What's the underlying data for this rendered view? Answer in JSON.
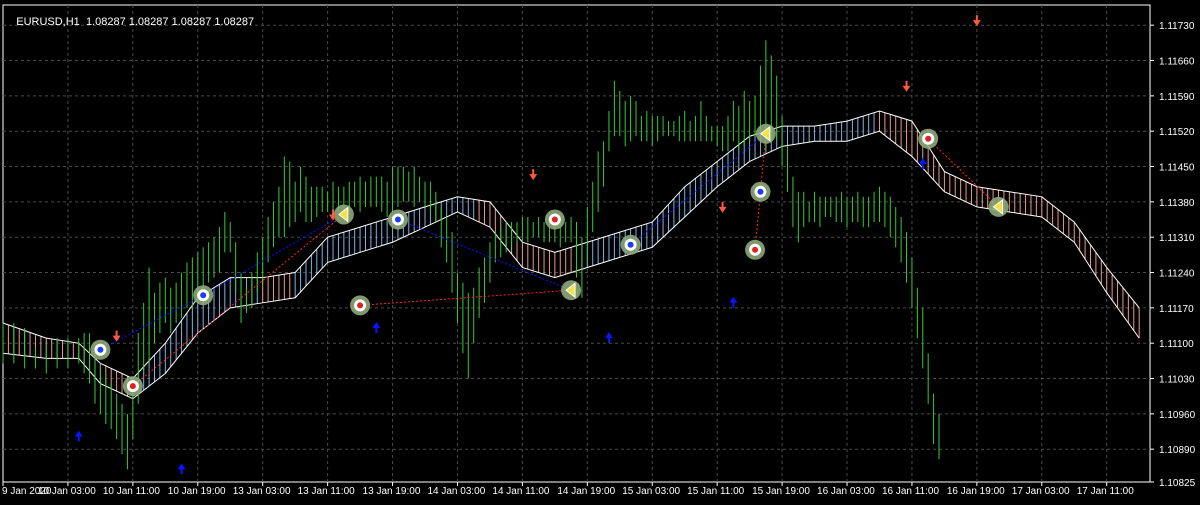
{
  "header": {
    "symbol_tf": "EURUSD,H1",
    "quote": "1.08287 1.08287 1.08287 1.08287"
  },
  "colors": {
    "background": "#000000",
    "grid": "#4a4a4a",
    "axis": "#ffffff",
    "text": "#ffffff",
    "candle": "#33cc33",
    "band_up": "#7fb2e6",
    "band_down": "#e89a8f",
    "band_edge": "#ffffff",
    "arrow_up": "#0a14ff",
    "arrow_down": "#ff5a40",
    "zz_up": "#0a14ff",
    "zz_down": "#ff2020",
    "marker_ring": "#8ea87a"
  },
  "chart_data": {
    "type": "line",
    "title": "EURUSD,H1",
    "y_ticks": [
      "1.11730",
      "1.11660",
      "1.11590",
      "1.11520",
      "1.11450",
      "1.11380",
      "1.11310",
      "1.11240",
      "1.11170",
      "1.11100",
      "1.11030",
      "1.10960",
      "1.10890",
      "1.10825"
    ],
    "ylim": [
      1.10825,
      1.1177
    ],
    "x_labels": [
      "9 Jan 2020",
      "10 Jan 03:00",
      "10 Jan 11:00",
      "10 Jan 19:00",
      "13 Jan 03:00",
      "13 Jan 11:00",
      "13 Jan 19:00",
      "14 Jan 03:00",
      "14 Jan 11:00",
      "14 Jan 19:00",
      "15 Jan 03:00",
      "15 Jan 11:00",
      "15 Jan 19:00",
      "16 Jan 03:00",
      "16 Jan 11:00",
      "16 Jan 19:00",
      "17 Jan 03:00",
      "17 Jan 11:00"
    ],
    "band": {
      "upper": [
        [
          0,
          1.1114
        ],
        [
          8,
          1.1111
        ],
        [
          14,
          1.111
        ],
        [
          18,
          1.1106
        ],
        [
          24,
          1.1103
        ],
        [
          30,
          1.111
        ],
        [
          36,
          1.1119
        ],
        [
          42,
          1.1123
        ],
        [
          48,
          1.1123
        ],
        [
          54,
          1.1124
        ],
        [
          60,
          1.1131
        ],
        [
          66,
          1.1133
        ],
        [
          72,
          1.1135
        ],
        [
          78,
          1.1137
        ],
        [
          84,
          1.1139
        ],
        [
          90,
          1.1138
        ],
        [
          96,
          1.113
        ],
        [
          102,
          1.1128
        ],
        [
          108,
          1.113
        ],
        [
          114,
          1.1132
        ],
        [
          120,
          1.1134
        ],
        [
          126,
          1.1141
        ],
        [
          132,
          1.1146
        ],
        [
          138,
          1.1151
        ],
        [
          144,
          1.1153
        ],
        [
          150,
          1.1153
        ],
        [
          156,
          1.1154
        ],
        [
          162,
          1.1156
        ],
        [
          168,
          1.1154
        ],
        [
          174,
          1.1144
        ],
        [
          180,
          1.1141
        ],
        [
          186,
          1.114
        ],
        [
          192,
          1.1139
        ],
        [
          198,
          1.1134
        ],
        [
          204,
          1.1125
        ],
        [
          210,
          1.1117
        ]
      ],
      "lower": [
        [
          0,
          1.1108
        ],
        [
          8,
          1.1107
        ],
        [
          14,
          1.1107
        ],
        [
          18,
          1.1102
        ],
        [
          24,
          1.1099
        ],
        [
          30,
          1.1104
        ],
        [
          36,
          1.1112
        ],
        [
          42,
          1.1117
        ],
        [
          48,
          1.1118
        ],
        [
          54,
          1.1119
        ],
        [
          60,
          1.1126
        ],
        [
          66,
          1.1128
        ],
        [
          72,
          1.113
        ],
        [
          78,
          1.1133
        ],
        [
          84,
          1.1136
        ],
        [
          90,
          1.1133
        ],
        [
          96,
          1.1125
        ],
        [
          102,
          1.1123
        ],
        [
          108,
          1.1125
        ],
        [
          114,
          1.1127
        ],
        [
          120,
          1.1129
        ],
        [
          126,
          1.1135
        ],
        [
          132,
          1.1141
        ],
        [
          138,
          1.1146
        ],
        [
          144,
          1.1149
        ],
        [
          150,
          1.115
        ],
        [
          156,
          1.115
        ],
        [
          162,
          1.1152
        ],
        [
          168,
          1.1147
        ],
        [
          174,
          1.114
        ],
        [
          180,
          1.1137
        ],
        [
          186,
          1.1136
        ],
        [
          192,
          1.1135
        ],
        [
          198,
          1.113
        ],
        [
          204,
          1.112
        ],
        [
          210,
          1.1111
        ]
      ],
      "direction": [
        [
          0,
          "down"
        ],
        [
          18,
          "down"
        ],
        [
          24,
          "up"
        ],
        [
          48,
          "down"
        ],
        [
          54,
          "up"
        ],
        [
          88,
          "down"
        ],
        [
          108,
          "up"
        ],
        [
          162,
          "down"
        ]
      ]
    },
    "bars": [
      [
        0,
        1.1106,
        1.1114
      ],
      [
        2,
        1.1106,
        1.1114
      ],
      [
        4,
        1.1105,
        1.1113
      ],
      [
        6,
        1.1105,
        1.1109
      ],
      [
        8,
        1.1104,
        1.111
      ],
      [
        10,
        1.1105,
        1.1111
      ],
      [
        12,
        1.1105,
        1.1111
      ],
      [
        14,
        1.1106,
        1.1111
      ],
      [
        15,
        1.1104,
        1.1112
      ],
      [
        16,
        1.1102,
        1.1112
      ],
      [
        17,
        1.1098,
        1.1108
      ],
      [
        18,
        1.1096,
        1.1106
      ],
      [
        19,
        1.1094,
        1.1104
      ],
      [
        20,
        1.1093,
        1.1102
      ],
      [
        21,
        1.1091,
        1.11
      ],
      [
        22,
        1.1088,
        1.1098
      ],
      [
        23,
        1.1085,
        1.1096
      ],
      [
        24,
        1.1091,
        1.11
      ],
      [
        25,
        1.1098,
        1.1112
      ],
      [
        26,
        1.1104,
        1.1118
      ],
      [
        27,
        1.1106,
        1.1125
      ],
      [
        28,
        1.111,
        1.112
      ],
      [
        29,
        1.1112,
        1.1122
      ],
      [
        30,
        1.1114,
        1.1123
      ],
      [
        31,
        1.1112,
        1.1121
      ],
      [
        32,
        1.1114,
        1.1122
      ],
      [
        33,
        1.1115,
        1.1124
      ],
      [
        34,
        1.1117,
        1.1126
      ],
      [
        35,
        1.1117,
        1.1127
      ],
      [
        36,
        1.1119,
        1.1128
      ],
      [
        37,
        1.112,
        1.1129
      ],
      [
        38,
        1.1122,
        1.113
      ],
      [
        39,
        1.1123,
        1.1131
      ],
      [
        40,
        1.1124,
        1.1133
      ],
      [
        41,
        1.1128,
        1.1136
      ],
      [
        42,
        1.1128,
        1.1134
      ],
      [
        43,
        1.112,
        1.113
      ],
      [
        44,
        1.1114,
        1.1124
      ],
      [
        45,
        1.1116,
        1.1121
      ],
      [
        46,
        1.1117,
        1.1124
      ],
      [
        47,
        1.112,
        1.1128
      ],
      [
        48,
        1.1122,
        1.1131
      ],
      [
        49,
        1.1126,
        1.1135
      ],
      [
        50,
        1.1129,
        1.1138
      ],
      [
        51,
        1.1131,
        1.1141
      ],
      [
        52,
        1.1131,
        1.1147
      ],
      [
        53,
        1.1133,
        1.1146
      ],
      [
        54,
        1.1134,
        1.1142
      ],
      [
        55,
        1.1136,
        1.1145
      ],
      [
        56,
        1.1134,
        1.1143
      ],
      [
        57,
        1.1134,
        1.1141
      ],
      [
        58,
        1.1135,
        1.1141
      ],
      [
        59,
        1.1136,
        1.1141
      ],
      [
        60,
        1.1136,
        1.114
      ],
      [
        61,
        1.1136,
        1.1142
      ],
      [
        62,
        1.1136,
        1.1141
      ],
      [
        63,
        1.1135,
        1.1141
      ],
      [
        64,
        1.1136,
        1.1142
      ],
      [
        65,
        1.1137,
        1.1142
      ],
      [
        66,
        1.1136,
        1.1143
      ],
      [
        67,
        1.1137,
        1.1142
      ],
      [
        68,
        1.1137,
        1.1143
      ],
      [
        69,
        1.1137,
        1.1143
      ],
      [
        70,
        1.1136,
        1.1143
      ],
      [
        71,
        1.1135,
        1.1142
      ],
      [
        72,
        1.1136,
        1.1145
      ],
      [
        73,
        1.1137,
        1.1145
      ],
      [
        74,
        1.1138,
        1.1145
      ],
      [
        75,
        1.1138,
        1.1144
      ],
      [
        76,
        1.1137,
        1.1145
      ],
      [
        77,
        1.1138,
        1.1143
      ],
      [
        78,
        1.1137,
        1.1142
      ],
      [
        79,
        1.1136,
        1.1142
      ],
      [
        80,
        1.1134,
        1.114
      ],
      [
        81,
        1.1129,
        1.1137
      ],
      [
        82,
        1.1126,
        1.1135
      ],
      [
        83,
        1.112,
        1.1132
      ],
      [
        84,
        1.1114,
        1.1124
      ],
      [
        85,
        1.1108,
        1.1122
      ],
      [
        86,
        1.1103,
        1.112
      ],
      [
        87,
        1.111,
        1.1121
      ],
      [
        88,
        1.1115,
        1.1125
      ],
      [
        89,
        1.1118,
        1.1127
      ],
      [
        90,
        1.1122,
        1.113
      ],
      [
        91,
        1.1126,
        1.1132
      ],
      [
        92,
        1.1127,
        1.1133
      ],
      [
        93,
        1.1128,
        1.1134
      ],
      [
        94,
        1.1129,
        1.1134
      ],
      [
        95,
        1.113,
        1.1134
      ],
      [
        96,
        1.113,
        1.1135
      ],
      [
        97,
        1.113,
        1.1135
      ],
      [
        98,
        1.1131,
        1.1134
      ],
      [
        99,
        1.1131,
        1.1135
      ],
      [
        100,
        1.113,
        1.1134
      ],
      [
        101,
        1.113,
        1.1134
      ],
      [
        102,
        1.113,
        1.1134
      ],
      [
        103,
        1.1129,
        1.1134
      ],
      [
        104,
        1.113,
        1.1134
      ],
      [
        105,
        1.113,
        1.1135
      ],
      [
        106,
        1.1123,
        1.1134
      ],
      [
        107,
        1.1119,
        1.1131
      ],
      [
        108,
        1.1126,
        1.1137
      ],
      [
        109,
        1.1132,
        1.1142
      ],
      [
        110,
        1.1136,
        1.1148
      ],
      [
        111,
        1.1141,
        1.115
      ],
      [
        112,
        1.1148,
        1.1156
      ],
      [
        113,
        1.1151,
        1.1162
      ],
      [
        114,
        1.1151,
        1.116
      ],
      [
        115,
        1.1149,
        1.1158
      ],
      [
        116,
        1.115,
        1.1159
      ],
      [
        117,
        1.1151,
        1.1158
      ],
      [
        118,
        1.115,
        1.1155
      ],
      [
        119,
        1.115,
        1.1156
      ],
      [
        120,
        1.1149,
        1.1155
      ],
      [
        121,
        1.115,
        1.1155
      ],
      [
        122,
        1.1151,
        1.1155
      ],
      [
        123,
        1.1151,
        1.1154
      ],
      [
        124,
        1.1151,
        1.1154
      ],
      [
        125,
        1.115,
        1.1155
      ],
      [
        126,
        1.115,
        1.1156
      ],
      [
        127,
        1.115,
        1.1154
      ],
      [
        128,
        1.115,
        1.1155
      ],
      [
        129,
        1.115,
        1.1158
      ],
      [
        130,
        1.115,
        1.1155
      ],
      [
        131,
        1.115,
        1.1153
      ],
      [
        132,
        1.1149,
        1.1153
      ],
      [
        133,
        1.1148,
        1.1153
      ],
      [
        134,
        1.1148,
        1.1155
      ],
      [
        135,
        1.115,
        1.1158
      ],
      [
        136,
        1.1148,
        1.1157
      ],
      [
        137,
        1.1149,
        1.116
      ],
      [
        138,
        1.115,
        1.1158
      ],
      [
        139,
        1.1151,
        1.1159
      ],
      [
        140,
        1.1151,
        1.1165
      ],
      [
        141,
        1.1148,
        1.117
      ],
      [
        142,
        1.115,
        1.1167
      ],
      [
        143,
        1.115,
        1.1163
      ],
      [
        144,
        1.1145,
        1.1155
      ],
      [
        145,
        1.114,
        1.1149
      ],
      [
        146,
        1.1133,
        1.1143
      ],
      [
        147,
        1.113,
        1.114
      ],
      [
        148,
        1.1133,
        1.114
      ],
      [
        149,
        1.1134,
        1.1138
      ],
      [
        150,
        1.1134,
        1.114
      ],
      [
        151,
        1.1133,
        1.1139
      ],
      [
        152,
        1.1135,
        1.1139
      ],
      [
        153,
        1.1135,
        1.1139
      ],
      [
        154,
        1.1134,
        1.1139
      ],
      [
        155,
        1.1134,
        1.114
      ],
      [
        156,
        1.1133,
        1.1139
      ],
      [
        157,
        1.1134,
        1.1139
      ],
      [
        158,
        1.1134,
        1.114
      ],
      [
        159,
        1.1133,
        1.1139
      ],
      [
        160,
        1.1133,
        1.1139
      ],
      [
        161,
        1.1134,
        1.114
      ],
      [
        162,
        1.1134,
        1.1141
      ],
      [
        163,
        1.1133,
        1.114
      ],
      [
        164,
        1.1131,
        1.1139
      ],
      [
        165,
        1.1129,
        1.1137
      ],
      [
        166,
        1.1126,
        1.1135
      ],
      [
        167,
        1.1122,
        1.1132
      ],
      [
        168,
        1.1117,
        1.1127
      ],
      [
        169,
        1.1111,
        1.1121
      ],
      [
        170,
        1.1105,
        1.1117
      ],
      [
        171,
        1.1098,
        1.1108
      ],
      [
        172,
        1.109,
        1.11
      ],
      [
        173,
        1.1087,
        1.1096
      ]
    ],
    "markers": [
      {
        "pos": 18,
        "price": 1.11087,
        "kind": "blue"
      },
      {
        "pos": 24,
        "price": 1.11015,
        "kind": "red"
      },
      {
        "pos": 37,
        "price": 1.11195,
        "kind": "blue"
      },
      {
        "pos": 63,
        "price": 1.11355,
        "kind": "yellow"
      },
      {
        "pos": 66,
        "price": 1.11175,
        "kind": "red"
      },
      {
        "pos": 73,
        "price": 1.11345,
        "kind": "blue"
      },
      {
        "pos": 102,
        "price": 1.11345,
        "kind": "red"
      },
      {
        "pos": 105,
        "price": 1.11205,
        "kind": "yellow"
      },
      {
        "pos": 116,
        "price": 1.11295,
        "kind": "blue"
      },
      {
        "pos": 139,
        "price": 1.11285,
        "kind": "red"
      },
      {
        "pos": 140,
        "price": 1.114,
        "kind": "blue"
      },
      {
        "pos": 141,
        "price": 1.11515,
        "kind": "yellow"
      },
      {
        "pos": 171,
        "price": 1.11505,
        "kind": "red"
      },
      {
        "pos": 184,
        "price": 1.1137,
        "kind": "yellow"
      }
    ],
    "arrows": [
      {
        "pos": 14,
        "price": 1.10915,
        "dir": "up"
      },
      {
        "pos": 21,
        "price": 1.11115,
        "dir": "down"
      },
      {
        "pos": 33,
        "price": 1.1085,
        "dir": "up"
      },
      {
        "pos": 61,
        "price": 1.11355,
        "dir": "down"
      },
      {
        "pos": 69,
        "price": 1.1113,
        "dir": "up"
      },
      {
        "pos": 98,
        "price": 1.11435,
        "dir": "down"
      },
      {
        "pos": 112,
        "price": 1.1111,
        "dir": "up"
      },
      {
        "pos": 133,
        "price": 1.1137,
        "dir": "down"
      },
      {
        "pos": 135,
        "price": 1.1118,
        "dir": "up"
      },
      {
        "pos": 167,
        "price": 1.1161,
        "dir": "down"
      },
      {
        "pos": 170,
        "price": 1.11455,
        "dir": "up"
      },
      {
        "pos": 180,
        "price": 1.1174,
        "dir": "down"
      }
    ],
    "zigzag": [
      {
        "color": "up",
        "points": [
          [
            18,
            1.11087
          ],
          [
            37,
            1.11195
          ],
          [
            63,
            1.11355
          ]
        ]
      },
      {
        "color": "down",
        "points": [
          [
            24,
            1.11015
          ],
          [
            63,
            1.11355
          ]
        ]
      },
      {
        "color": "down",
        "points": [
          [
            66,
            1.11175
          ],
          [
            105,
            1.11205
          ]
        ]
      },
      {
        "color": "up",
        "points": [
          [
            73,
            1.11345
          ],
          [
            105,
            1.11205
          ]
        ]
      },
      {
        "color": "up",
        "points": [
          [
            116,
            1.11295
          ],
          [
            141,
            1.11515
          ]
        ]
      },
      {
        "color": "down",
        "points": [
          [
            139,
            1.11285
          ],
          [
            141,
            1.11515
          ]
        ]
      },
      {
        "color": "down",
        "points": [
          [
            171,
            1.11505
          ],
          [
            184,
            1.1137
          ]
        ]
      }
    ]
  }
}
